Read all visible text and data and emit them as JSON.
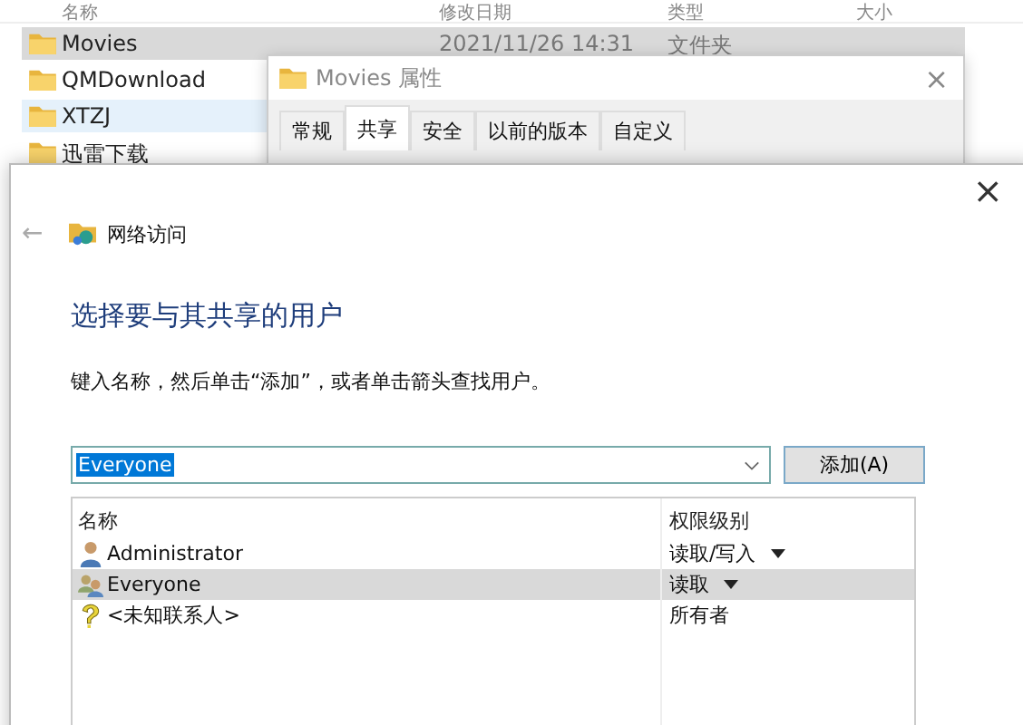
{
  "explorer": {
    "columns": [
      "名称",
      "修改日期",
      "类型",
      "大小"
    ],
    "rows": [
      {
        "name": "Movies",
        "date": "2021/11/26 14:31",
        "type": "文件夹",
        "selected": true,
        "hover": false
      },
      {
        "name": "QMDownload",
        "selected": false,
        "hover": false
      },
      {
        "name": "XTZJ",
        "selected": false,
        "hover": true
      },
      {
        "name": "迅雷下载",
        "selected": false,
        "hover": false
      }
    ]
  },
  "properties": {
    "title": "Movies 属性",
    "close": "×",
    "tabs": [
      {
        "label": "常规",
        "selected": false
      },
      {
        "label": "共享",
        "selected": true
      },
      {
        "label": "安全",
        "selected": false
      },
      {
        "label": "以前的版本",
        "selected": false
      },
      {
        "label": "自定义",
        "selected": false
      }
    ]
  },
  "share_dialog": {
    "close": "×",
    "back": "←",
    "breadcrumb": "网络访问",
    "heading": "选择要与其共享的用户",
    "instruction": "键入名称，然后单击“添加”，或者单击箭头查找用户。",
    "name_field": {
      "value": "Everyone",
      "selected_text": true
    },
    "add_button": "添加(A)",
    "table": {
      "columns": [
        "名称",
        "权限级别"
      ],
      "rows": [
        {
          "kind": "user",
          "name": "Administrator",
          "permission": "读取/写入",
          "dropdown": true,
          "selected": false
        },
        {
          "kind": "group",
          "name": "Everyone",
          "permission": "读取",
          "dropdown": true,
          "selected": true
        },
        {
          "kind": "unknown",
          "name": "<未知联系人>",
          "permission": "所有者",
          "dropdown": false,
          "selected": false
        }
      ]
    }
  }
}
